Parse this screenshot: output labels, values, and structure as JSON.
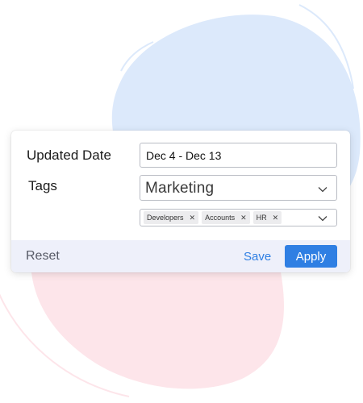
{
  "colors": {
    "accent": "#2f7fe3",
    "blob_blue": "#dce9fb",
    "blob_pink": "#fde5ea",
    "footer_bg": "#eef0fa"
  },
  "filter": {
    "date_label": "Updated Date",
    "date_value": "Dec 4 - Dec 13",
    "tags_label": "Tags",
    "tags_selected": "Marketing",
    "chips": [
      {
        "label": "Developers",
        "remove_icon": "close-icon"
      },
      {
        "label": "Accounts",
        "remove_icon": "close-icon"
      },
      {
        "label": "HR",
        "remove_icon": "close-icon"
      }
    ]
  },
  "footer": {
    "reset_label": "Reset",
    "save_label": "Save",
    "apply_label": "Apply"
  }
}
